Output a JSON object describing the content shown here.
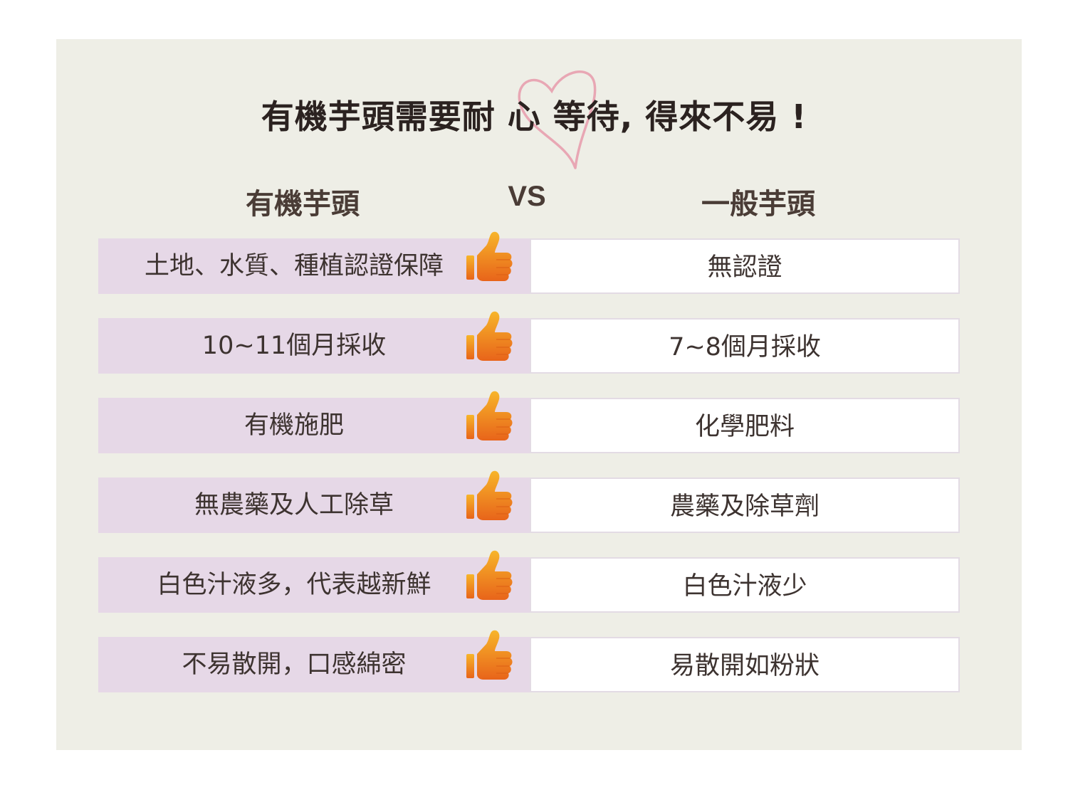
{
  "title": "有機芋頭需要耐 心 等待, 得來不易 !",
  "columns": {
    "left": "有機芋頭",
    "middle": "VS",
    "right": "一般芋頭"
  },
  "rows": [
    {
      "left": "土地、水質、種植認證保障",
      "right": "無認證"
    },
    {
      "left": "10~11個月採收",
      "right": "7~8個月採收"
    },
    {
      "left": "有機施肥",
      "right": "化學肥料"
    },
    {
      "left": "無農藥及人工除草",
      "right": "農藥及除草劑"
    },
    {
      "left": "白色汁液多，代表越新鮮",
      "right": "白色汁液少"
    },
    {
      "left": "不易散開，口感綿密",
      "right": "易散開如粉狀"
    }
  ],
  "icons": {
    "thumb": "thumbs-up-icon",
    "heart": "heart-outline-icon"
  },
  "colors": {
    "panel_bg": "#eeeee6",
    "left_cell_bg": "#e6d8e7",
    "right_cell_border": "#e3dbe4",
    "thumb_light": "#f7b52a",
    "thumb_dark": "#e8641a",
    "heart": "#e8a7b4"
  }
}
